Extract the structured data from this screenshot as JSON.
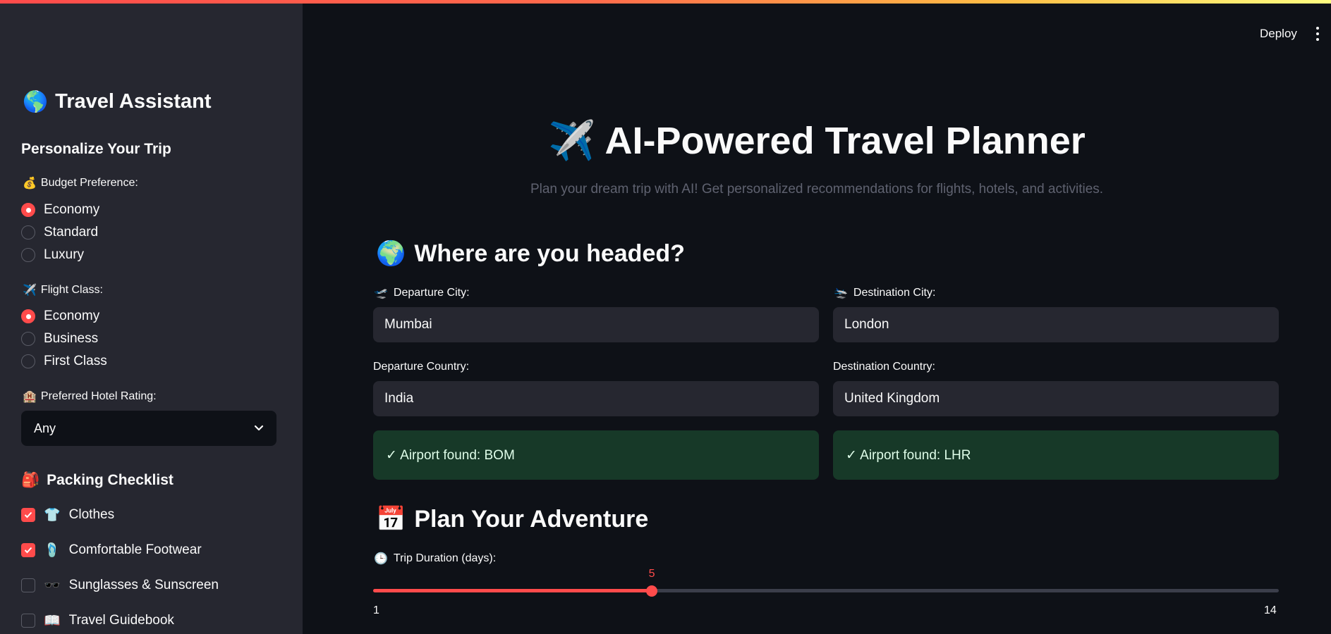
{
  "header": {
    "deploy_label": "Deploy"
  },
  "sidebar": {
    "title": "Travel Assistant",
    "title_icon": "🌎",
    "personalize_heading": "Personalize Your Trip",
    "budget": {
      "icon": "💰",
      "label": "Budget Preference:",
      "options": [
        "Economy",
        "Standard",
        "Luxury"
      ],
      "selected": "Economy"
    },
    "flight_class": {
      "icon": "✈️",
      "label": "Flight Class:",
      "options": [
        "Economy",
        "Business",
        "First Class"
      ],
      "selected": "Economy"
    },
    "hotel_rating": {
      "icon": "🏨",
      "label": "Preferred Hotel Rating:",
      "value": "Any"
    },
    "packing": {
      "icon": "🎒",
      "heading": "Packing Checklist",
      "items": [
        {
          "icon": "👕",
          "label": "Clothes",
          "checked": true
        },
        {
          "icon": "🩴",
          "label": "Comfortable Footwear",
          "checked": true
        },
        {
          "icon": "🕶️",
          "label": "Sunglasses & Sunscreen",
          "checked": false
        },
        {
          "icon": "📖",
          "label": "Travel Guidebook",
          "checked": false
        }
      ]
    }
  },
  "main": {
    "title_icon": "✈️",
    "title": "AI-Powered Travel Planner",
    "subtitle": "Plan your dream trip with AI! Get personalized recommendations for flights, hotels, and activities.",
    "where": {
      "icon": "🌍",
      "heading": "Where are you headed?",
      "departure_city": {
        "icon": "🛫",
        "label": "Departure City:",
        "value": "Mumbai"
      },
      "destination_city": {
        "icon": "🛬",
        "label": "Destination City:",
        "value": "London"
      },
      "departure_country": {
        "label": "Departure Country:",
        "value": "India"
      },
      "destination_country": {
        "label": "Destination Country:",
        "value": "United Kingdom"
      },
      "departure_airport": "✓ Airport found: BOM",
      "destination_airport": "✓ Airport found: LHR"
    },
    "plan": {
      "icon": "📅",
      "heading": "Plan Your Adventure",
      "duration": {
        "icon": "🕒",
        "label": "Trip Duration (days):",
        "value": 5,
        "value_text": "5",
        "min": 1,
        "min_text": "1",
        "max": 14,
        "max_text": "14"
      }
    }
  },
  "colors": {
    "accent": "#ff4b4b",
    "background": "#0e1117",
    "sidebar": "#262730",
    "success_bg": "#173928"
  }
}
